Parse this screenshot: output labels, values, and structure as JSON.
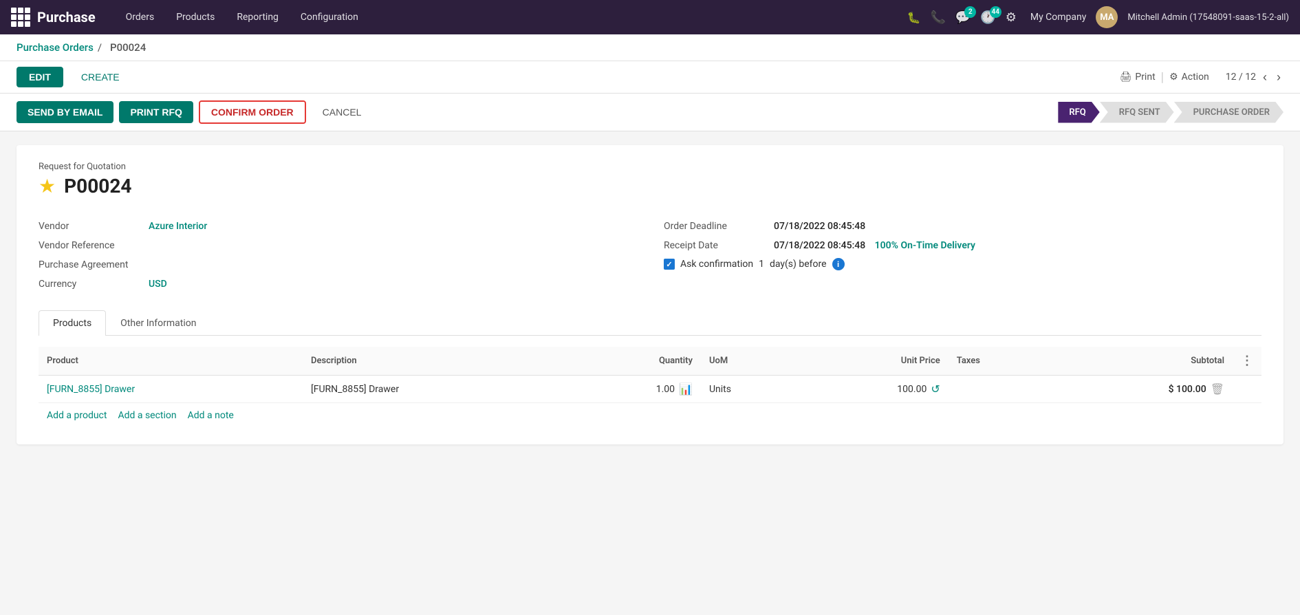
{
  "topnav": {
    "brand": "Purchase",
    "menu": [
      "Orders",
      "Products",
      "Reporting",
      "Configuration"
    ],
    "company": "My Company",
    "username": "Mitchell Admin (17548091-saas-15-2-all)",
    "chat_badge": "2",
    "activity_badge": "44"
  },
  "breadcrumb": {
    "parent": "Purchase Orders",
    "separator": "/",
    "current": "P00024"
  },
  "toolbar": {
    "edit_label": "EDIT",
    "create_label": "CREATE",
    "print_label": "Print",
    "action_label": "Action",
    "pagination": "12 / 12"
  },
  "workflow": {
    "send_email_label": "SEND BY EMAIL",
    "print_rfq_label": "PRINT RFQ",
    "confirm_order_label": "CONFIRM ORDER",
    "cancel_label": "CANCEL",
    "status_steps": [
      {
        "label": "RFQ",
        "active": true
      },
      {
        "label": "RFQ SENT",
        "active": false
      },
      {
        "label": "PURCHASE ORDER",
        "active": false
      }
    ]
  },
  "document": {
    "subtitle": "Request for Quotation",
    "order_number": "P00024",
    "vendor_label": "Vendor",
    "vendor_value": "Azure Interior",
    "vendor_ref_label": "Vendor Reference",
    "vendor_ref_value": "",
    "purchase_agreement_label": "Purchase Agreement",
    "purchase_agreement_value": "",
    "currency_label": "Currency",
    "currency_value": "USD",
    "order_deadline_label": "Order Deadline",
    "order_deadline_value": "07/18/2022 08:45:48",
    "receipt_date_label": "Receipt Date",
    "receipt_date_value": "07/18/2022 08:45:48",
    "on_time_delivery": "100% On-Time Delivery",
    "ask_confirmation_label": "Ask confirmation",
    "ask_confirmation_days": "1",
    "ask_confirmation_suffix": "day(s) before"
  },
  "tabs": [
    {
      "label": "Products",
      "active": true
    },
    {
      "label": "Other Information",
      "active": false
    }
  ],
  "table": {
    "headers": [
      "Product",
      "Description",
      "Quantity",
      "UoM",
      "Unit Price",
      "Taxes",
      "Subtotal"
    ],
    "rows": [
      {
        "product": "[FURN_8855] Drawer",
        "description": "[FURN_8855] Drawer",
        "quantity": "1.00",
        "uom": "Units",
        "unit_price": "100.00",
        "taxes": "",
        "subtotal": "$ 100.00"
      }
    ],
    "add_product": "Add a product",
    "add_section": "Add a section",
    "add_note": "Add a note"
  }
}
